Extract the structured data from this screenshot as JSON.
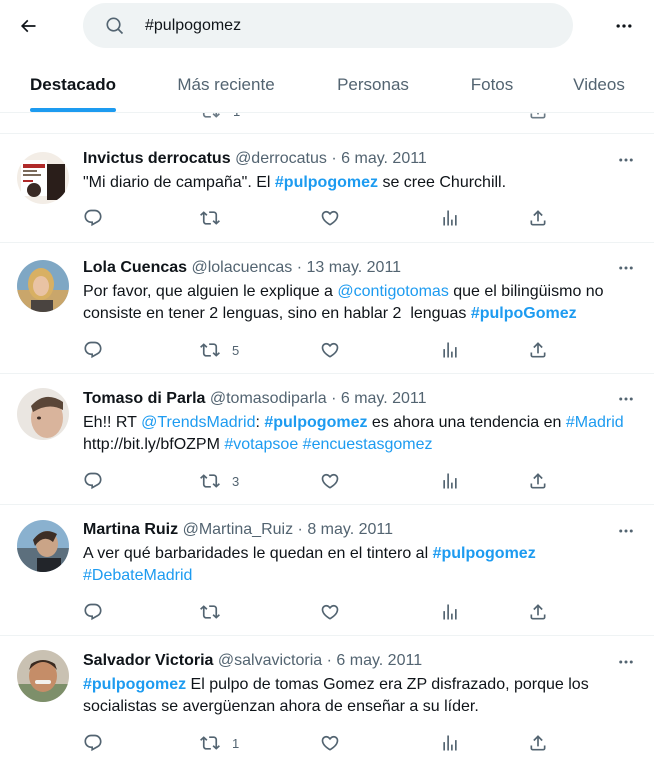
{
  "search": {
    "query": "#pulpogomez"
  },
  "tabs": [
    "Destacado",
    "Más reciente",
    "Personas",
    "Fotos",
    "Videos"
  ],
  "partial_tweet": {
    "retweets": "1"
  },
  "tweets": [
    {
      "name": "Invictus derrocatus",
      "handle": "@derrocatus",
      "date": "6 may. 2011",
      "text": [
        "\"Mi diario de campaña\". El ",
        "#pulpogomez",
        " se cree Churchill."
      ],
      "retweets": ""
    },
    {
      "name": "Lola Cuencas",
      "handle": "@lolacuencas",
      "date": "13 may. 2011",
      "text": [
        "Por favor, que alguien le explique a ",
        "@contigotomas",
        " que el bilingüismo no consiste en tener 2 lenguas, sino en hablar 2  lenguas ",
        "#pulpoGomez"
      ],
      "retweets": "5"
    },
    {
      "name": "Tomaso di Parla",
      "handle": "@tomasodiparla",
      "date": "6 may. 2011",
      "text": [
        "Eh!! RT ",
        "@TrendsMadrid",
        ": ",
        "#pulpogomez",
        " es ahora una tendencia en ",
        "#Madrid",
        " http://bit.ly/bfOZPM ",
        "#votapsoe",
        " ",
        "#encuestasgomez"
      ],
      "retweets": "3"
    },
    {
      "name": "Martina Ruiz",
      "handle": "@Martina_Ruiz",
      "date": "8 may. 2011",
      "text": [
        "A ver qué barbaridades le quedan en el tintero al ",
        "#pulpogomez",
        "\n",
        "#DebateMadrid"
      ],
      "retweets": ""
    },
    {
      "name": "Salvador Victoria",
      "handle": "@salvavictoria",
      "date": "6 may. 2011",
      "text": [
        "#pulpogomez",
        " El pulpo de tomas Gomez era ZP disfrazado, porque los socialistas se avergüenzan ahora de enseñar a su líder."
      ],
      "retweets": "1"
    }
  ],
  "colors": {
    "accent": "#1d9bf0",
    "text": "#0f1419",
    "muted": "#536471",
    "divider": "#eff3f4"
  }
}
